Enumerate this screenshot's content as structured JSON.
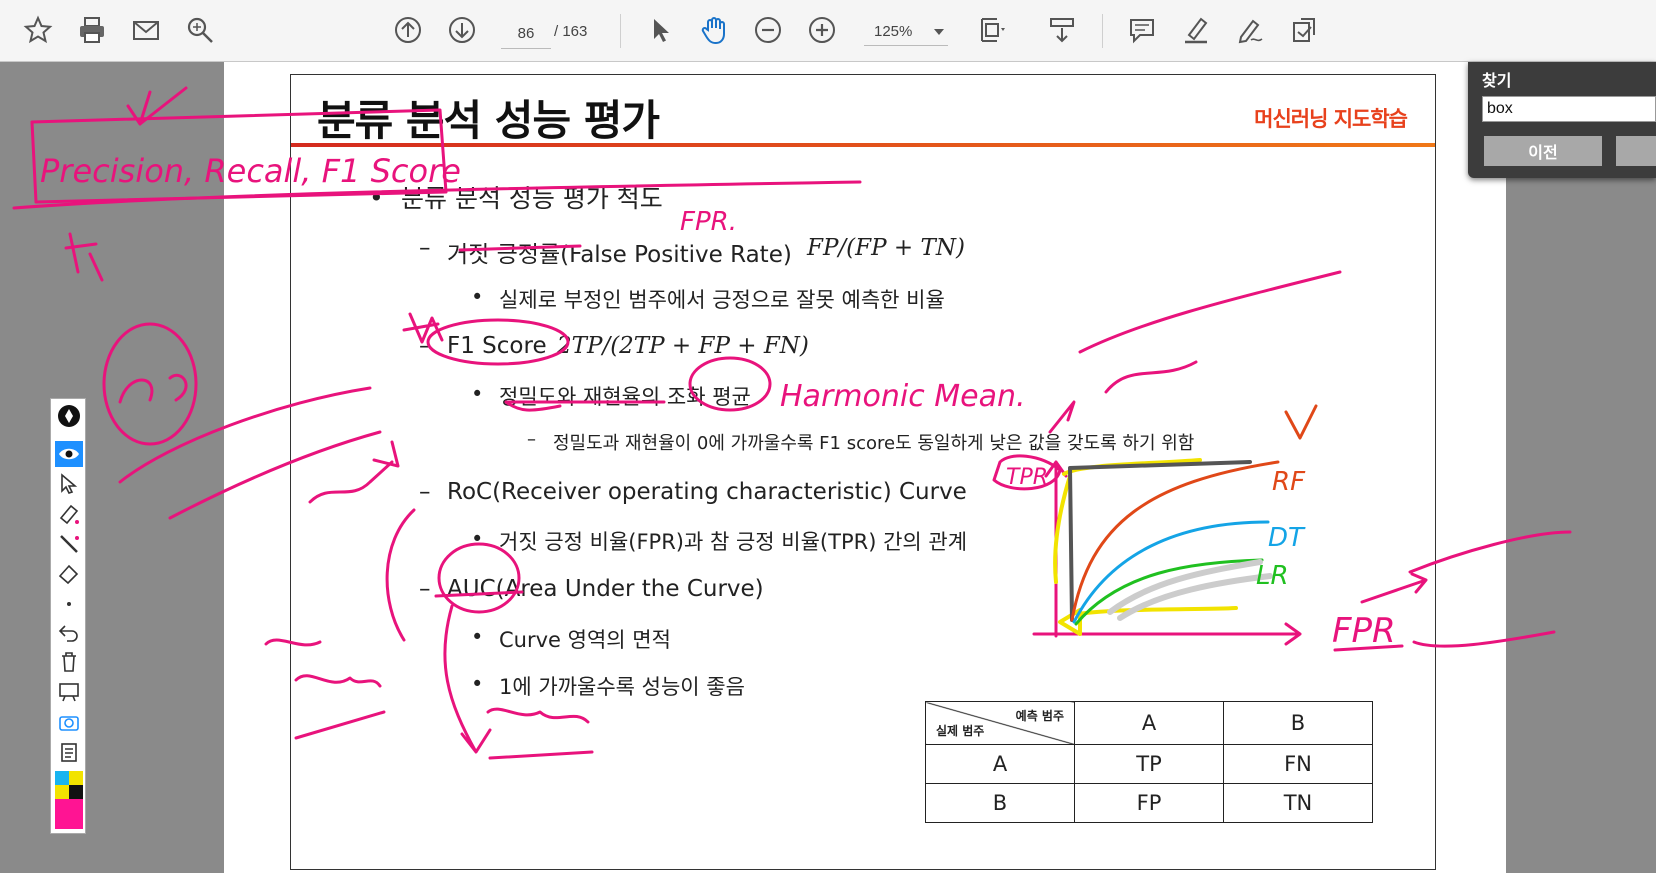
{
  "toolbar": {
    "page_current": "86",
    "page_total": "/  163",
    "zoom": "125%",
    "icons": [
      "star-icon",
      "print-icon",
      "mail-icon",
      "search-icon",
      "page-up-icon",
      "page-down-icon",
      "select-cursor-icon",
      "hand-tool-icon",
      "zoom-out-icon",
      "zoom-in-icon",
      "fit-page-icon",
      "scroll-mode-icon",
      "comment-icon",
      "highlight-icon",
      "sign-icon",
      "share-icon"
    ]
  },
  "slide": {
    "title": "분류 분석 성능 평가",
    "subject": "머신러닝 지도학습",
    "items": [
      {
        "bullet": "•",
        "text": "분류 분석 성능 평가 척도"
      },
      {
        "bullet": "–",
        "text": "거짓 긍정률(False Positive Rate)",
        "formula": "FP/(FP + TN)"
      },
      {
        "bullet": "•",
        "text": "실제로 부정인 범주에서 긍정으로 잘못 예측한 비율"
      },
      {
        "bullet": "–",
        "text": "F1 Score",
        "formula": "2TP/(2TP + FP + FN)"
      },
      {
        "bullet": "•",
        "text": "정밀도와 재현율의 조화 평균"
      },
      {
        "bullet": "–",
        "text": "정밀도과 재현율이 0에 가까울수록 F1 score도 동일하게 낮은 값을 갖도록 하기 위함"
      },
      {
        "bullet": "–",
        "text": "RoC(Receiver operating characteristic) Curve"
      },
      {
        "bullet": "•",
        "text": "거짓 긍정 비율(FPR)과 참 긍정 비율(TPR) 간의 관계"
      },
      {
        "bullet": "–",
        "text": "AUC(Area Under the Curve)"
      },
      {
        "bullet": "•",
        "text": "Curve 영역의 면적"
      },
      {
        "bullet": "•",
        "text": "1에 가까울수록 성능이 좋음"
      }
    ],
    "table": {
      "corner_pred": "예측 범주",
      "corner_actual": "실제 범주",
      "col_headers": [
        "A",
        "B"
      ],
      "rows": [
        {
          "label": "A",
          "cells": [
            "TP",
            "FN"
          ]
        },
        {
          "label": "B",
          "cells": [
            "FP",
            "TN"
          ]
        }
      ]
    }
  },
  "find": {
    "title": "찾기",
    "query": "box",
    "prev_label": "이전"
  },
  "annotations": {
    "ink_color": "#e8137c",
    "labels": [
      "Precision, Recall, F1 Score",
      "FPR.",
      "Harmonic Mean.",
      "TPR",
      "RF",
      "DT",
      "LR",
      "FPR"
    ]
  },
  "pen_tools": [
    "pen-icon",
    "eye-icon",
    "pointer-icon",
    "marker-icon",
    "line-icon",
    "eraser-icon",
    "dot-icon",
    "undo-icon",
    "trash-icon",
    "board-icon",
    "camera-icon",
    "clipboard-icon",
    "color-palette"
  ]
}
